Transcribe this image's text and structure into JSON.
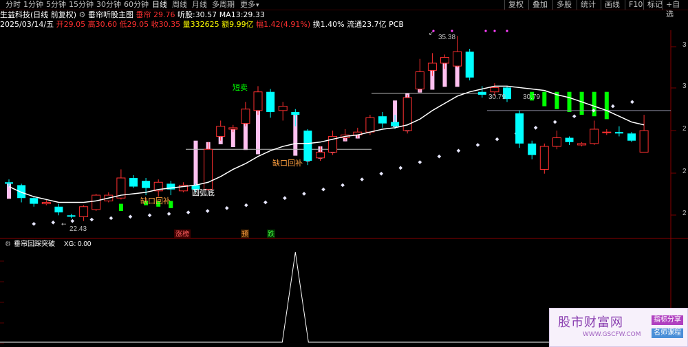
{
  "periods": [
    "分时",
    "1分钟",
    "5分钟",
    "15分钟",
    "30分钟",
    "60分钟",
    "日线",
    "周线",
    "月线",
    "多周期",
    "更多"
  ],
  "active_period": "日线",
  "right_toolbar": [
    "复权",
    "叠加",
    "多股",
    "统计",
    "画线",
    "F10",
    "标记",
    "+自选"
  ],
  "header": {
    "stock_name": "生益科技",
    "mode": "(日线 前复权)",
    "indicator_name": "垂帘听股主图",
    "cur_label": "垂帘",
    "cur_value": "29.76",
    "ting_label": "听股:",
    "ting_value": "30.57",
    "ma_label": "MA13:",
    "ma_value": "29.33"
  },
  "quote": {
    "date": "2025/03/14/五",
    "open_label": "开",
    "open": "29.05",
    "high_label": "高",
    "high": "30.60",
    "low_label": "低",
    "low": "29.05",
    "close_label": "收",
    "close": "30.35",
    "vol_label": "量",
    "vol": "332625",
    "amount_label": "额",
    "amount": "9.99亿",
    "chg_label": "幅",
    "chg": "1.42(4.91%)",
    "turnover": "换1.40%",
    "float": "流通23.7亿",
    "pcb": "PCB"
  },
  "annotations": {
    "high_price": "35.38",
    "low_price": "22.43",
    "line_price": "30.79",
    "line_price2": "30.79",
    "duanmai": "短卖",
    "quekou1": "缺口回补",
    "quekou2": "缺口回补",
    "yuanhudi": "圆弧底"
  },
  "markers": {
    "zhangting": "涨榜",
    "yu": "预",
    "die": "跌"
  },
  "right_axis_labels": [
    "3",
    "3",
    "2",
    "2",
    "2"
  ],
  "sub": {
    "title": "垂帘回踩突破",
    "xg_label": "XG:",
    "xg_value": "0.00"
  },
  "watermark": {
    "title": "股市财富网",
    "url": "WWW.GSCFW.COM",
    "tag1": "指标分享",
    "tag2": "名师课程"
  },
  "colors": {
    "up": "#ff3030",
    "down": "#00ffff",
    "pink_bar": "#ffc0f0",
    "green_bar": "#00ff00",
    "ma_line": "#ffffff",
    "dot": "#e8e8ff",
    "grid": "#7a0000"
  },
  "candles": [
    {
      "o": 27.3,
      "c": 27.2,
      "h": 27.5,
      "l": 27.0
    },
    {
      "o": 27.1,
      "c": 26.2,
      "h": 27.2,
      "l": 25.9
    },
    {
      "o": 26.2,
      "c": 25.8,
      "h": 26.3,
      "l": 25.6
    },
    {
      "o": 25.8,
      "c": 25.9,
      "h": 26.1,
      "l": 25.7
    },
    {
      "o": 25.6,
      "c": 25.2,
      "h": 25.8,
      "l": 25.0
    },
    {
      "o": 25.0,
      "c": 24.9,
      "h": 25.1,
      "l": 24.8
    },
    {
      "o": 24.9,
      "c": 25.6,
      "h": 25.7,
      "l": 24.6
    },
    {
      "o": 25.4,
      "c": 26.4,
      "h": 26.5,
      "l": 25.3
    },
    {
      "o": 26.0,
      "c": 26.4,
      "h": 26.6,
      "l": 25.9
    },
    {
      "o": 26.2,
      "c": 27.6,
      "h": 28.2,
      "l": 26.1
    },
    {
      "o": 27.6,
      "c": 27.0,
      "h": 27.8,
      "l": 26.9
    },
    {
      "o": 27.4,
      "c": 26.9,
      "h": 27.6,
      "l": 26.4
    },
    {
      "o": 26.7,
      "c": 27.3,
      "h": 27.5,
      "l": 26.3
    },
    {
      "o": 27.2,
      "c": 26.8,
      "h": 27.4,
      "l": 26.4
    },
    {
      "o": 26.7,
      "c": 27.1,
      "h": 27.3,
      "l": 26.6
    },
    {
      "o": 27.1,
      "c": 26.8,
      "h": 27.2,
      "l": 26.6
    },
    {
      "o": 26.8,
      "c": 29.6,
      "h": 30.1,
      "l": 26.7
    },
    {
      "o": 30.5,
      "c": 31.2,
      "h": 31.6,
      "l": 30.2
    },
    {
      "o": 31.0,
      "c": 31.1,
      "h": 31.3,
      "l": 30.8
    },
    {
      "o": 31.4,
      "c": 32.4,
      "h": 32.9,
      "l": 31.2
    },
    {
      "o": 32.3,
      "c": 33.6,
      "h": 34.0,
      "l": 32.0
    },
    {
      "o": 33.6,
      "c": 32.2,
      "h": 33.8,
      "l": 31.8
    },
    {
      "o": 32.3,
      "c": 32.6,
      "h": 32.9,
      "l": 31.6
    },
    {
      "o": 32.2,
      "c": 32.0,
      "h": 32.4,
      "l": 31.2
    },
    {
      "o": 30.9,
      "c": 28.8,
      "h": 31.0,
      "l": 28.5
    },
    {
      "o": 29.0,
      "c": 29.4,
      "h": 29.8,
      "l": 28.8
    },
    {
      "o": 29.4,
      "c": 30.5,
      "h": 30.9,
      "l": 29.2
    },
    {
      "o": 30.4,
      "c": 30.6,
      "h": 31.0,
      "l": 30.2
    },
    {
      "o": 30.6,
      "c": 30.8,
      "h": 31.1,
      "l": 30.4
    },
    {
      "o": 30.8,
      "c": 31.8,
      "h": 32.0,
      "l": 30.6
    },
    {
      "o": 31.9,
      "c": 31.4,
      "h": 32.2,
      "l": 31.1
    },
    {
      "o": 31.5,
      "c": 31.2,
      "h": 32.0,
      "l": 31.0
    },
    {
      "o": 30.9,
      "c": 33.2,
      "h": 33.4,
      "l": 30.7
    },
    {
      "o": 33.8,
      "c": 35.0,
      "h": 35.9,
      "l": 33.6
    },
    {
      "o": 35.1,
      "c": 35.6,
      "h": 36.3,
      "l": 34.7
    },
    {
      "o": 35.6,
      "c": 36.0,
      "h": 36.2,
      "l": 35.2
    },
    {
      "o": 35.4,
      "c": 36.4,
      "h": 37.5,
      "l": 35.3
    },
    {
      "o": 36.4,
      "c": 34.6,
      "h": 36.6,
      "l": 34.4
    },
    {
      "o": 33.6,
      "c": 33.4,
      "h": 34.0,
      "l": 33.2
    },
    {
      "o": 33.6,
      "c": 33.9,
      "h": 34.2,
      "l": 33.3
    },
    {
      "o": 33.9,
      "c": 33.1,
      "h": 34.0,
      "l": 32.9
    },
    {
      "o": 32.1,
      "c": 30.0,
      "h": 32.3,
      "l": 29.7
    },
    {
      "o": 30.0,
      "c": 29.2,
      "h": 30.2,
      "l": 28.9
    },
    {
      "o": 28.2,
      "c": 29.8,
      "h": 30.0,
      "l": 27.9
    },
    {
      "o": 29.8,
      "c": 30.4,
      "h": 30.9,
      "l": 29.6
    },
    {
      "o": 30.4,
      "c": 30.1,
      "h": 30.5,
      "l": 29.9
    },
    {
      "o": 29.9,
      "c": 30.0,
      "h": 30.1,
      "l": 29.8
    },
    {
      "o": 30.0,
      "c": 31.0,
      "h": 31.6,
      "l": 29.9
    },
    {
      "o": 30.8,
      "c": 30.8,
      "h": 31.0,
      "l": 30.6
    },
    {
      "o": 30.8,
      "c": 30.7,
      "h": 31.2,
      "l": 30.5
    },
    {
      "o": 30.7,
      "c": 30.2,
      "h": 30.8,
      "l": 30.1
    },
    {
      "o": 29.4,
      "c": 30.9,
      "h": 32.0,
      "l": 29.4
    }
  ],
  "ma13": [
    27.0,
    26.6,
    26.3,
    26.1,
    25.9,
    25.9,
    25.9,
    26.0,
    26.2,
    26.4,
    26.5,
    26.6,
    26.8,
    26.9,
    27.0,
    27.1,
    27.3,
    27.7,
    28.2,
    28.6,
    29.1,
    29.5,
    29.8,
    30.0,
    30.0,
    30.1,
    30.3,
    30.5,
    30.6,
    30.8,
    31.0,
    31.1,
    31.3,
    31.7,
    32.3,
    32.8,
    33.3,
    33.6,
    33.8,
    34.0,
    34.0,
    33.9,
    33.8,
    33.7,
    33.4,
    33.2,
    32.9,
    32.6,
    32.3,
    31.9,
    31.5,
    31.3
  ],
  "pink_bars": [
    {
      "i": 0,
      "v": 26.2
    },
    {
      "i": 15,
      "v": 30.2
    },
    {
      "i": 16,
      "v": 30.1
    },
    {
      "i": 17,
      "v": 30.0
    },
    {
      "i": 18,
      "v": 29.8
    },
    {
      "i": 19,
      "v": 29.6
    },
    {
      "i": 20,
      "v": 29.3
    },
    {
      "i": 23,
      "v": 29.2
    },
    {
      "i": 24,
      "v": 29.0
    },
    {
      "i": 25,
      "v": 29.8
    },
    {
      "i": 26,
      "v": 30.0
    },
    {
      "i": 27,
      "v": 30.2
    },
    {
      "i": 28,
      "v": 30.4
    },
    {
      "i": 31,
      "v": 33.0
    },
    {
      "i": 32,
      "v": 33.5
    },
    {
      "i": 33,
      "v": 33.6
    },
    {
      "i": 34,
      "v": 33.8
    },
    {
      "i": 35,
      "v": 34.0
    },
    {
      "i": 36,
      "v": 34.0
    }
  ],
  "green_bars": [
    {
      "i": 9,
      "top": 25.8,
      "bot": 25.3
    },
    {
      "i": 11,
      "top": 26.0,
      "bot": 25.7
    },
    {
      "i": 12,
      "top": 26.0,
      "bot": 25.6
    },
    {
      "i": 13,
      "top": 26.0,
      "bot": 25.5
    },
    {
      "i": 42,
      "top": 33.6,
      "bot": 33.0
    },
    {
      "i": 43,
      "top": 33.6,
      "bot": 32.6
    },
    {
      "i": 44,
      "top": 33.6,
      "bot": 32.4
    },
    {
      "i": 45,
      "top": 33.6,
      "bot": 32.2
    },
    {
      "i": 46,
      "top": 33.6,
      "bot": 32.0
    },
    {
      "i": 47,
      "top": 33.6,
      "bot": 31.9
    },
    {
      "i": 48,
      "top": 33.6,
      "bot": 31.7
    }
  ],
  "dots": [
    24.4,
    24.5,
    24.6,
    24.7,
    24.8,
    24.9,
    25.0,
    25.1,
    25.2,
    25.3,
    25.5,
    25.7,
    25.9,
    26.2,
    26.5,
    26.8,
    27.1,
    27.5,
    27.9,
    28.3,
    28.7,
    29.1,
    29.5,
    29.9,
    30.3,
    30.7,
    31.1,
    31.5,
    31.9,
    32.3,
    32.6,
    32.9
  ],
  "sub_spike": {
    "index": 23,
    "value": 1
  }
}
